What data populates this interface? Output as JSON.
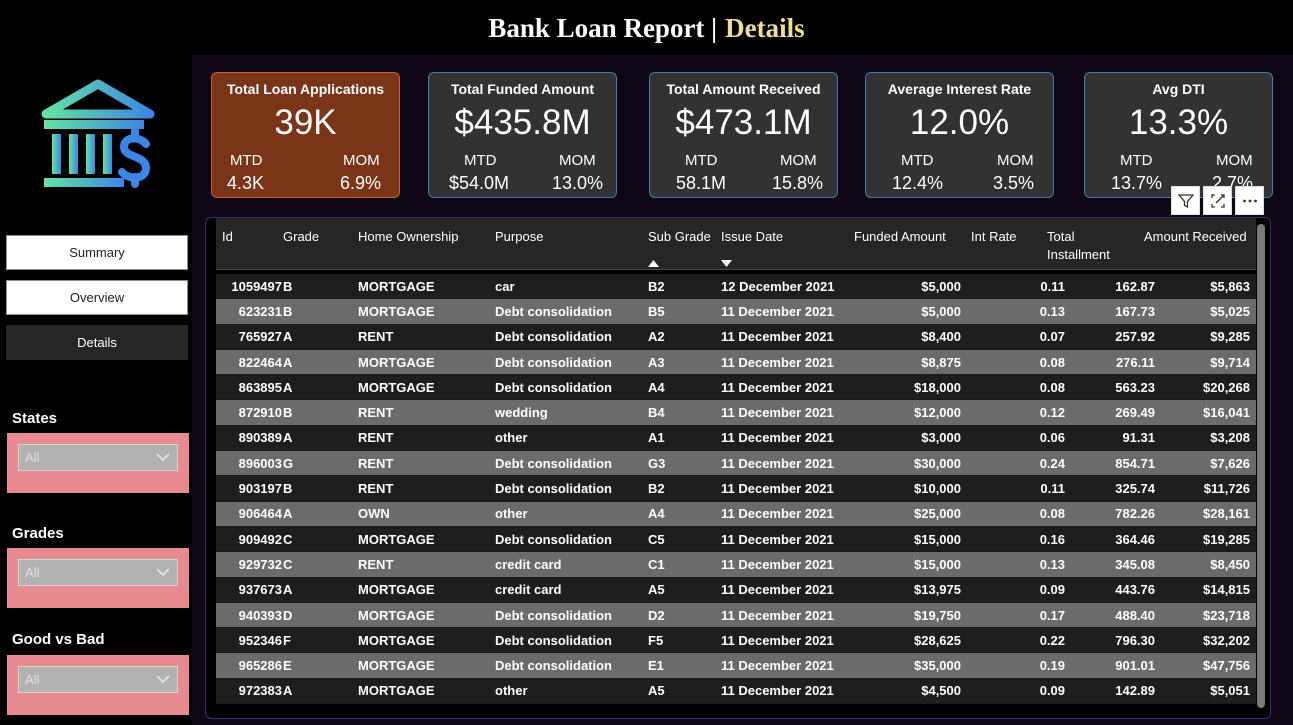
{
  "header": {
    "title_main": "Bank Loan Report |",
    "title_accent": "Details"
  },
  "colors": {
    "highlight_card": "#7a3519",
    "card": "#323232",
    "card_border": "#3e7ea8",
    "slicer_bg": "#e78b91",
    "accent_title": "#f0dd95"
  },
  "logo": {
    "icon": "bank-dollar-icon"
  },
  "nav": [
    {
      "label": "Summary",
      "active": false
    },
    {
      "label": "Overview",
      "active": false
    },
    {
      "label": "Details",
      "active": true
    }
  ],
  "slicers": [
    {
      "label": "States",
      "value": "All"
    },
    {
      "label": "Grades",
      "value": "All"
    },
    {
      "label": "Good vs Bad",
      "value": "All"
    }
  ],
  "kpis": [
    {
      "title": "Total Loan Applications",
      "value": "39K",
      "mtd_label": "MTD",
      "mtd": "4.3K",
      "mom_label": "MOM",
      "mom": "6.9%",
      "highlight": true
    },
    {
      "title": "Total Funded Amount",
      "value": "$435.8M",
      "mtd_label": "MTD",
      "mtd": "$54.0M",
      "mom_label": "MOM",
      "mom": "13.0%",
      "highlight": false
    },
    {
      "title": "Total Amount Received",
      "value": "$473.1M",
      "mtd_label": "MTD",
      "mtd": "58.1M",
      "mom_label": "MOM",
      "mom": "15.8%",
      "highlight": false
    },
    {
      "title": "Average Interest Rate",
      "value": "12.0%",
      "mtd_label": "MTD",
      "mtd": "12.4%",
      "mom_label": "MOM",
      "mom": "3.5%",
      "highlight": false
    },
    {
      "title": "Avg DTI",
      "value": "13.3%",
      "mtd_label": "MTD",
      "mtd": "13.7%",
      "mom_label": "MOM",
      "mom": "2.7%",
      "highlight": false
    }
  ],
  "visual_header_icons": [
    "filter-icon",
    "focus-mode-icon",
    "more-options-icon"
  ],
  "table": {
    "columns": [
      "Id",
      "Grade",
      "Home Ownership",
      "Purpose",
      "Sub Grade",
      "Issue Date",
      "Funded Amount",
      "Int Rate",
      "Total Installment",
      "Amount Received"
    ],
    "sorted_columns": {
      "Sub Grade": "ascending",
      "Issue Date": "descending"
    },
    "rows": [
      [
        "1059497",
        "B",
        "MORTGAGE",
        "car",
        "B2",
        "12 December 2021",
        "$5,000",
        "0.11",
        "162.87",
        "$5,863"
      ],
      [
        "623231",
        "B",
        "MORTGAGE",
        "Debt consolidation",
        "B5",
        "11 December 2021",
        "$5,000",
        "0.13",
        "167.73",
        "$5,025"
      ],
      [
        "765927",
        "A",
        "RENT",
        "Debt consolidation",
        "A2",
        "11 December 2021",
        "$8,400",
        "0.07",
        "257.92",
        "$9,285"
      ],
      [
        "822464",
        "A",
        "MORTGAGE",
        "Debt consolidation",
        "A3",
        "11 December 2021",
        "$8,875",
        "0.08",
        "276.11",
        "$9,714"
      ],
      [
        "863895",
        "A",
        "MORTGAGE",
        "Debt consolidation",
        "A4",
        "11 December 2021",
        "$18,000",
        "0.08",
        "563.23",
        "$20,268"
      ],
      [
        "872910",
        "B",
        "RENT",
        "wedding",
        "B4",
        "11 December 2021",
        "$12,000",
        "0.12",
        "269.49",
        "$16,041"
      ],
      [
        "890389",
        "A",
        "RENT",
        "other",
        "A1",
        "11 December 2021",
        "$3,000",
        "0.06",
        "91.31",
        "$3,208"
      ],
      [
        "896003",
        "G",
        "RENT",
        "Debt consolidation",
        "G3",
        "11 December 2021",
        "$30,000",
        "0.24",
        "854.71",
        "$7,626"
      ],
      [
        "903197",
        "B",
        "RENT",
        "Debt consolidation",
        "B2",
        "11 December 2021",
        "$10,000",
        "0.11",
        "325.74",
        "$11,726"
      ],
      [
        "906464",
        "A",
        "OWN",
        "other",
        "A4",
        "11 December 2021",
        "$25,000",
        "0.08",
        "782.26",
        "$28,161"
      ],
      [
        "909492",
        "C",
        "MORTGAGE",
        "Debt consolidation",
        "C5",
        "11 December 2021",
        "$15,000",
        "0.16",
        "364.46",
        "$19,285"
      ],
      [
        "929732",
        "C",
        "RENT",
        "credit card",
        "C1",
        "11 December 2021",
        "$15,000",
        "0.13",
        "345.08",
        "$8,450"
      ],
      [
        "937673",
        "A",
        "MORTGAGE",
        "credit card",
        "A5",
        "11 December 2021",
        "$13,975",
        "0.09",
        "443.76",
        "$14,815"
      ],
      [
        "940393",
        "D",
        "MORTGAGE",
        "Debt consolidation",
        "D2",
        "11 December 2021",
        "$19,750",
        "0.17",
        "488.40",
        "$23,718"
      ],
      [
        "952346",
        "F",
        "MORTGAGE",
        "Debt consolidation",
        "F5",
        "11 December 2021",
        "$28,625",
        "0.22",
        "796.30",
        "$32,202"
      ],
      [
        "965286",
        "E",
        "MORTGAGE",
        "Debt consolidation",
        "E1",
        "11 December 2021",
        "$35,000",
        "0.19",
        "901.01",
        "$47,756"
      ],
      [
        "972383",
        "A",
        "MORTGAGE",
        "other",
        "A5",
        "11 December 2021",
        "$4,500",
        "0.09",
        "142.89",
        "$5,051"
      ]
    ]
  }
}
